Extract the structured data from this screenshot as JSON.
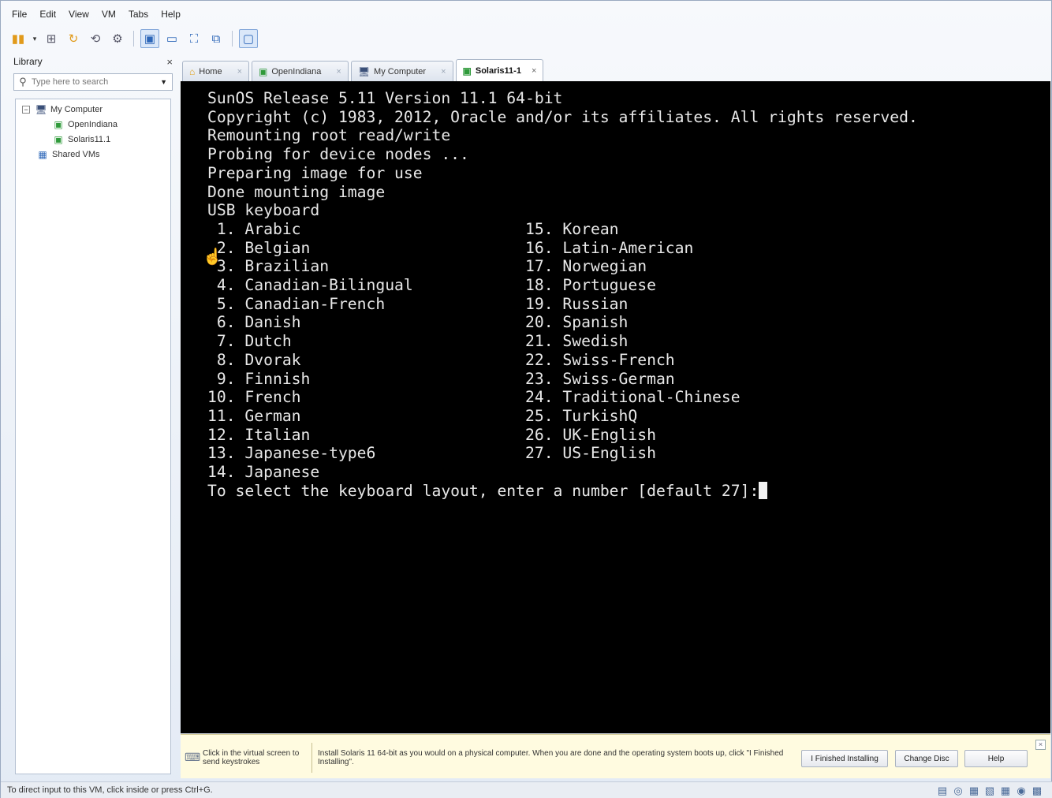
{
  "menu": {
    "items": [
      "File",
      "Edit",
      "View",
      "VM",
      "Tabs",
      "Help"
    ]
  },
  "toolbar": {
    "buttons": [
      {
        "name": "power-icon",
        "glyph": "▮▮"
      },
      {
        "name": "power-dropdown-icon",
        "glyph": "▾"
      },
      {
        "name": "network-icon",
        "glyph": "⊞"
      },
      {
        "name": "snapshot-take-icon",
        "glyph": "↻"
      },
      {
        "name": "snapshot-revert-icon",
        "glyph": "⟲"
      },
      {
        "name": "snapshot-manager-icon",
        "glyph": "⚙"
      },
      {
        "name": "show-library-icon",
        "glyph": "▣"
      },
      {
        "name": "thumbnail-bar-icon",
        "glyph": "▭"
      },
      {
        "name": "full-screen-icon",
        "glyph": "⛶"
      },
      {
        "name": "unity-icon",
        "glyph": "⧉"
      },
      {
        "name": "console-view-icon",
        "glyph": "▢"
      }
    ]
  },
  "library": {
    "title": "Library",
    "search_placeholder": "Type here to search",
    "tree": [
      {
        "label": "My Computer",
        "icon": "computer-icon",
        "level": 0,
        "expanded": true
      },
      {
        "label": "OpenIndiana",
        "icon": "vm-icon",
        "level": 1
      },
      {
        "label": "Solaris11.1",
        "icon": "vm-icon",
        "level": 1
      },
      {
        "label": "Shared VMs",
        "icon": "shared-vms-icon",
        "level": 0
      }
    ]
  },
  "tabs": [
    {
      "label": "Home",
      "icon": "home-icon",
      "active": false
    },
    {
      "label": "OpenIndiana",
      "icon": "vm-icon",
      "active": false
    },
    {
      "label": "My Computer",
      "icon": "computer-icon",
      "active": false
    },
    {
      "label": "Solaris11-1",
      "icon": "vm-icon",
      "active": true
    }
  ],
  "console": {
    "lines": [
      "SunOS Release 5.11 Version 11.1 64-bit",
      "Copyright (c) 1983, 2012, Oracle and/or its affiliates. All rights reserved.",
      "Remounting root read/write",
      "Probing for device nodes ...",
      "Preparing image for use",
      "Done mounting image",
      "USB keyboard"
    ],
    "keyboard_layouts": [
      {
        "num": "1.",
        "name": "Arabic"
      },
      {
        "num": "2.",
        "name": "Belgian"
      },
      {
        "num": "3.",
        "name": "Brazilian"
      },
      {
        "num": "4.",
        "name": "Canadian-Bilingual"
      },
      {
        "num": "5.",
        "name": "Canadian-French"
      },
      {
        "num": "6.",
        "name": "Danish"
      },
      {
        "num": "7.",
        "name": "Dutch"
      },
      {
        "num": "8.",
        "name": "Dvorak"
      },
      {
        "num": "9.",
        "name": "Finnish"
      },
      {
        "num": "10.",
        "name": "French"
      },
      {
        "num": "11.",
        "name": "German"
      },
      {
        "num": "12.",
        "name": "Italian"
      },
      {
        "num": "13.",
        "name": "Japanese-type6"
      },
      {
        "num": "14.",
        "name": "Japanese"
      },
      {
        "num": "15.",
        "name": "Korean"
      },
      {
        "num": "16.",
        "name": "Latin-American"
      },
      {
        "num": "17.",
        "name": "Norwegian"
      },
      {
        "num": "18.",
        "name": "Portuguese"
      },
      {
        "num": "19.",
        "name": "Russian"
      },
      {
        "num": "20.",
        "name": "Spanish"
      },
      {
        "num": "21.",
        "name": "Swedish"
      },
      {
        "num": "22.",
        "name": "Swiss-French"
      },
      {
        "num": "23.",
        "name": "Swiss-German"
      },
      {
        "num": "24.",
        "name": "Traditional-Chinese"
      },
      {
        "num": "25.",
        "name": "TurkishQ"
      },
      {
        "num": "26.",
        "name": "UK-English"
      },
      {
        "num": "27.",
        "name": "US-English"
      }
    ],
    "prompt": "To select the keyboard layout, enter a number [default 27]:"
  },
  "hint_bar": {
    "left_text": "Click in the virtual screen to send keystrokes",
    "main_text": "Install Solaris 11 64-bit as you would on a physical computer. When you are done and the operating system boots up, click \"I Finished Installing\".",
    "buttons": [
      "I Finished Installing",
      "Change Disc",
      "Help"
    ]
  },
  "status_bar": {
    "text": "To direct input to this VM, click inside or press Ctrl+G."
  }
}
